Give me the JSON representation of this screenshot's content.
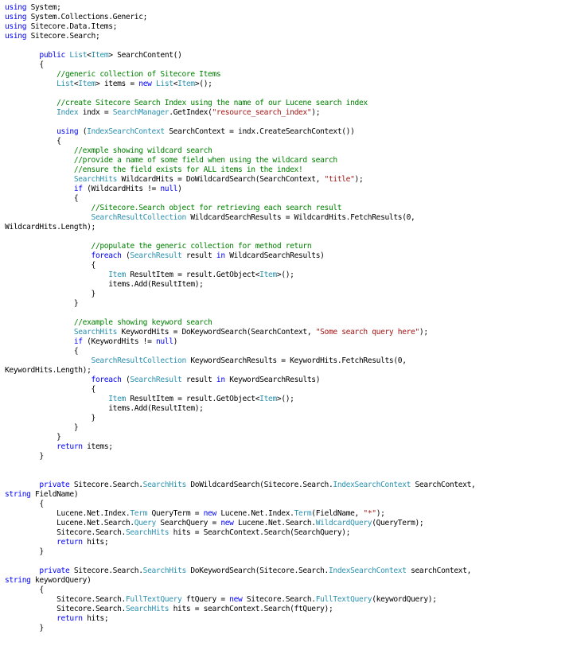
{
  "colors": {
    "background": "#ffffff",
    "text": "#000000",
    "keyword": "#0000ff",
    "type": "#2b91af",
    "comment": "#008000",
    "string": "#a31515"
  },
  "lines": [
    [
      [
        "kw",
        "using"
      ],
      [
        "t",
        " System;"
      ]
    ],
    [
      [
        "kw",
        "using"
      ],
      [
        "t",
        " System.Collections.Generic;"
      ]
    ],
    [
      [
        "kw",
        "using"
      ],
      [
        "t",
        " Sitecore.Data.Items;"
      ]
    ],
    [
      [
        "kw",
        "using"
      ],
      [
        "t",
        " Sitecore.Search;"
      ]
    ],
    [],
    [
      [
        "t",
        "        "
      ],
      [
        "kw",
        "public"
      ],
      [
        "t",
        " "
      ],
      [
        "ty",
        "List"
      ],
      [
        "t",
        "<"
      ],
      [
        "ty",
        "Item"
      ],
      [
        "t",
        "> SearchContent()"
      ]
    ],
    [
      [
        "t",
        "        {"
      ]
    ],
    [
      [
        "t",
        "            "
      ],
      [
        "cm",
        "//generic collection of Sitecore Items"
      ]
    ],
    [
      [
        "t",
        "            "
      ],
      [
        "ty",
        "List"
      ],
      [
        "t",
        "<"
      ],
      [
        "ty",
        "Item"
      ],
      [
        "t",
        "> items = "
      ],
      [
        "kw",
        "new"
      ],
      [
        "t",
        " "
      ],
      [
        "ty",
        "List"
      ],
      [
        "t",
        "<"
      ],
      [
        "ty",
        "Item"
      ],
      [
        "t",
        ">();"
      ]
    ],
    [],
    [
      [
        "t",
        "            "
      ],
      [
        "cm",
        "//create Sitecore Search Index using the name of our Lucene search index"
      ]
    ],
    [
      [
        "t",
        "            "
      ],
      [
        "ty",
        "Index"
      ],
      [
        "t",
        " indx = "
      ],
      [
        "ty",
        "SearchManager"
      ],
      [
        "t",
        ".GetIndex("
      ],
      [
        "st",
        "\"resource_search_index\""
      ],
      [
        "t",
        ");"
      ]
    ],
    [],
    [
      [
        "t",
        "            "
      ],
      [
        "kw",
        "using"
      ],
      [
        "t",
        " ("
      ],
      [
        "ty",
        "IndexSearchContext"
      ],
      [
        "t",
        " SearchContext = indx.CreateSearchContext())"
      ]
    ],
    [
      [
        "t",
        "            {"
      ]
    ],
    [
      [
        "t",
        "                "
      ],
      [
        "cm",
        "//exmple showing wildcard search"
      ]
    ],
    [
      [
        "t",
        "                "
      ],
      [
        "cm",
        "//provide a name of some field when using the wildcard search"
      ]
    ],
    [
      [
        "t",
        "                "
      ],
      [
        "cm",
        "//ensure the field exists for ALL items in the index!"
      ]
    ],
    [
      [
        "t",
        "                "
      ],
      [
        "ty",
        "SearchHits"
      ],
      [
        "t",
        " WildcardHits = DoWildcardSearch(SearchContext, "
      ],
      [
        "st",
        "\"title\""
      ],
      [
        "t",
        ");"
      ]
    ],
    [
      [
        "t",
        "                "
      ],
      [
        "kw",
        "if"
      ],
      [
        "t",
        " (WildcardHits != "
      ],
      [
        "kw",
        "null"
      ],
      [
        "t",
        ")"
      ]
    ],
    [
      [
        "t",
        "                {"
      ]
    ],
    [
      [
        "t",
        "                    "
      ],
      [
        "cm",
        "//Sitecore.Search object for retrieving each search result"
      ]
    ],
    [
      [
        "t",
        "                    "
      ],
      [
        "ty",
        "SearchResultCollection"
      ],
      [
        "t",
        " WildcardSearchResults = WildcardHits.FetchResults(0,"
      ]
    ],
    [
      [
        "t",
        "WildcardHits.Length);"
      ]
    ],
    [],
    [
      [
        "t",
        "                    "
      ],
      [
        "cm",
        "//populate the generic collection for method return"
      ]
    ],
    [
      [
        "t",
        "                    "
      ],
      [
        "kw",
        "foreach"
      ],
      [
        "t",
        " ("
      ],
      [
        "ty",
        "SearchResult"
      ],
      [
        "t",
        " result "
      ],
      [
        "kw",
        "in"
      ],
      [
        "t",
        " WildcardSearchResults)"
      ]
    ],
    [
      [
        "t",
        "                    {"
      ]
    ],
    [
      [
        "t",
        "                        "
      ],
      [
        "ty",
        "Item"
      ],
      [
        "t",
        " ResultItem = result.GetObject<"
      ],
      [
        "ty",
        "Item"
      ],
      [
        "t",
        ">();"
      ]
    ],
    [
      [
        "t",
        "                        items.Add(ResultItem);"
      ]
    ],
    [
      [
        "t",
        "                    }"
      ]
    ],
    [
      [
        "t",
        "                }"
      ]
    ],
    [],
    [
      [
        "t",
        "                "
      ],
      [
        "cm",
        "//example showing keyword search"
      ]
    ],
    [
      [
        "t",
        "                "
      ],
      [
        "ty",
        "SearchHits"
      ],
      [
        "t",
        " KeywordHits = DoKeywordSearch(SearchContext, "
      ],
      [
        "st",
        "\"Some search query here\""
      ],
      [
        "t",
        ");"
      ]
    ],
    [
      [
        "t",
        "                "
      ],
      [
        "kw",
        "if"
      ],
      [
        "t",
        " (KeywordHits != "
      ],
      [
        "kw",
        "null"
      ],
      [
        "t",
        ")"
      ]
    ],
    [
      [
        "t",
        "                {"
      ]
    ],
    [
      [
        "t",
        "                    "
      ],
      [
        "ty",
        "SearchResultCollection"
      ],
      [
        "t",
        " KeywordSearchResults = KeywordHits.FetchResults(0,"
      ]
    ],
    [
      [
        "t",
        "KeywordHits.Length);"
      ]
    ],
    [
      [
        "t",
        "                    "
      ],
      [
        "kw",
        "foreach"
      ],
      [
        "t",
        " ("
      ],
      [
        "ty",
        "SearchResult"
      ],
      [
        "t",
        " result "
      ],
      [
        "kw",
        "in"
      ],
      [
        "t",
        " KeywordSearchResults)"
      ]
    ],
    [
      [
        "t",
        "                    {"
      ]
    ],
    [
      [
        "t",
        "                        "
      ],
      [
        "ty",
        "Item"
      ],
      [
        "t",
        " ResultItem = result.GetObject<"
      ],
      [
        "ty",
        "Item"
      ],
      [
        "t",
        ">();"
      ]
    ],
    [
      [
        "t",
        "                        items.Add(ResultItem);"
      ]
    ],
    [
      [
        "t",
        "                    }"
      ]
    ],
    [
      [
        "t",
        "                }"
      ]
    ],
    [
      [
        "t",
        "            }"
      ]
    ],
    [
      [
        "t",
        "            "
      ],
      [
        "kw",
        "return"
      ],
      [
        "t",
        " items;"
      ]
    ],
    [
      [
        "t",
        "        }"
      ]
    ],
    [],
    [],
    [
      [
        "t",
        "        "
      ],
      [
        "kw",
        "private"
      ],
      [
        "t",
        " Sitecore.Search."
      ],
      [
        "ty",
        "SearchHits"
      ],
      [
        "t",
        " DoWildcardSearch(Sitecore.Search."
      ],
      [
        "ty",
        "IndexSearchContext"
      ],
      [
        "t",
        " SearchContext,"
      ]
    ],
    [
      [
        "kw",
        "string"
      ],
      [
        "t",
        " FieldName)"
      ]
    ],
    [
      [
        "t",
        "        {"
      ]
    ],
    [
      [
        "t",
        "            Lucene.Net.Index."
      ],
      [
        "ty",
        "Term"
      ],
      [
        "t",
        " QueryTerm = "
      ],
      [
        "kw",
        "new"
      ],
      [
        "t",
        " Lucene.Net.Index."
      ],
      [
        "ty",
        "Term"
      ],
      [
        "t",
        "(FieldName, "
      ],
      [
        "st",
        "\"*\""
      ],
      [
        "t",
        ");"
      ]
    ],
    [
      [
        "t",
        "            Lucene.Net.Search."
      ],
      [
        "ty",
        "Query"
      ],
      [
        "t",
        " SearchQuery = "
      ],
      [
        "kw",
        "new"
      ],
      [
        "t",
        " Lucene.Net.Search."
      ],
      [
        "ty",
        "WildcardQuery"
      ],
      [
        "t",
        "(QueryTerm);"
      ]
    ],
    [
      [
        "t",
        "            Sitecore.Search."
      ],
      [
        "ty",
        "SearchHits"
      ],
      [
        "t",
        " hits = SearchContext.Search(SearchQuery);"
      ]
    ],
    [
      [
        "t",
        "            "
      ],
      [
        "kw",
        "return"
      ],
      [
        "t",
        " hits;"
      ]
    ],
    [
      [
        "t",
        "        }"
      ]
    ],
    [],
    [
      [
        "t",
        "        "
      ],
      [
        "kw",
        "private"
      ],
      [
        "t",
        " Sitecore.Search."
      ],
      [
        "ty",
        "SearchHits"
      ],
      [
        "t",
        " DoKeywordSearch(Sitecore.Search."
      ],
      [
        "ty",
        "IndexSearchContext"
      ],
      [
        "t",
        " searchContext,"
      ]
    ],
    [
      [
        "kw",
        "string"
      ],
      [
        "t",
        " keywordQuery)"
      ]
    ],
    [
      [
        "t",
        "        {"
      ]
    ],
    [
      [
        "t",
        "            Sitecore.Search."
      ],
      [
        "ty",
        "FullTextQuery"
      ],
      [
        "t",
        " ftQuery = "
      ],
      [
        "kw",
        "new"
      ],
      [
        "t",
        " Sitecore.Search."
      ],
      [
        "ty",
        "FullTextQuery"
      ],
      [
        "t",
        "(keywordQuery);"
      ]
    ],
    [
      [
        "t",
        "            Sitecore.Search."
      ],
      [
        "ty",
        "SearchHits"
      ],
      [
        "t",
        " hits = searchContext.Search(ftQuery);"
      ]
    ],
    [
      [
        "t",
        "            "
      ],
      [
        "kw",
        "return"
      ],
      [
        "t",
        " hits;"
      ]
    ],
    [
      [
        "t",
        "        }"
      ]
    ]
  ]
}
